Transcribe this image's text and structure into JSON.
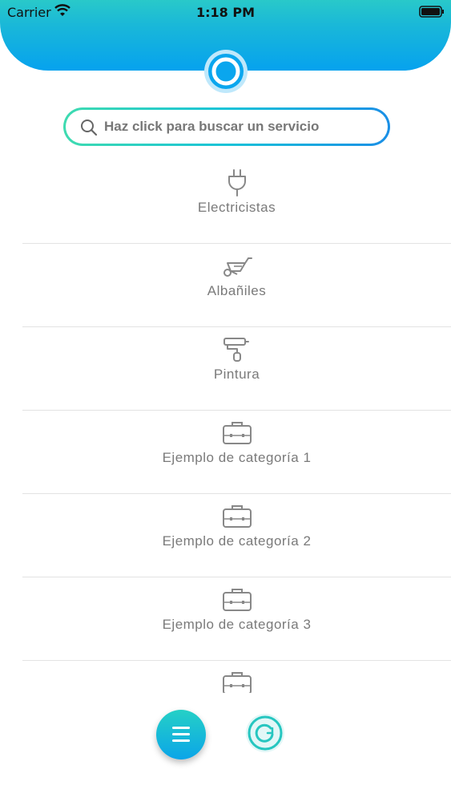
{
  "status_bar": {
    "carrier": "Carrier",
    "time": "1:18 PM"
  },
  "search": {
    "placeholder": "Haz click para buscar un servicio"
  },
  "categories": [
    {
      "label": "Electricistas",
      "icon": "plug-icon"
    },
    {
      "label": "Albañiles",
      "icon": "wheelbarrow-icon"
    },
    {
      "label": "Pintura",
      "icon": "paint-roller-icon"
    },
    {
      "label": "Ejemplo de categoría 1",
      "icon": "briefcase-icon"
    },
    {
      "label": "Ejemplo de categoría 2",
      "icon": "briefcase-icon"
    },
    {
      "label": "Ejemplo de categoría 3",
      "icon": "briefcase-icon"
    },
    {
      "label": "",
      "icon": "briefcase-icon"
    }
  ],
  "colors": {
    "header_gradient_start": "#29c9c9",
    "header_gradient_end": "#06a2ee",
    "accent": "#1ab8d8"
  }
}
